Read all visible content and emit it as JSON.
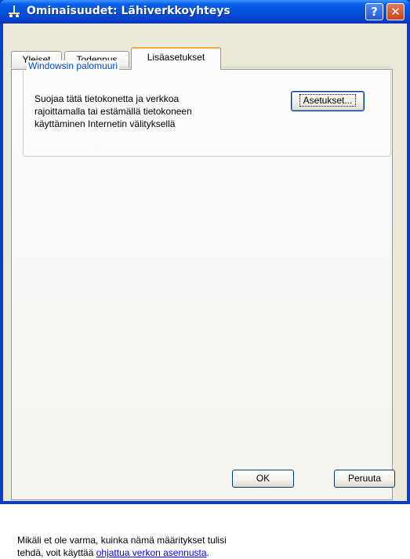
{
  "window": {
    "title": "Ominaisuudet: Lähiverkkoyhteys",
    "help_button": "?",
    "close_button": "✕"
  },
  "tabs": [
    {
      "label": "Yleiset",
      "active": false
    },
    {
      "label": "Todennus",
      "active": false
    },
    {
      "label": "Lisäasetukset",
      "active": true
    }
  ],
  "firewall_group": {
    "title": "Windowsin palomuuri",
    "description": "Suojaa tätä tietokonetta ja verkkoa\nrajoittamalla tai estämällä tietokoneen\nkäyttäminen Internetin välityksellä",
    "settings_button": "Asetukset..."
  },
  "footer": {
    "text_line1": "Mikäli et ole varma, kuinka nämä määritykset tulisi",
    "text_line2_prefix": "tehdä, voit käyttää ",
    "link": "ohjattua verkon asennusta",
    "text_line2_suffix": "."
  },
  "buttons": {
    "ok": "OK",
    "cancel": "Peruuta"
  },
  "colors": {
    "titlebar": "#0453dc",
    "dialog_bg": "#ece9d8",
    "group_title": "#0046d5",
    "link": "#0000ff",
    "active_tab_accent": "#f2a23e"
  }
}
